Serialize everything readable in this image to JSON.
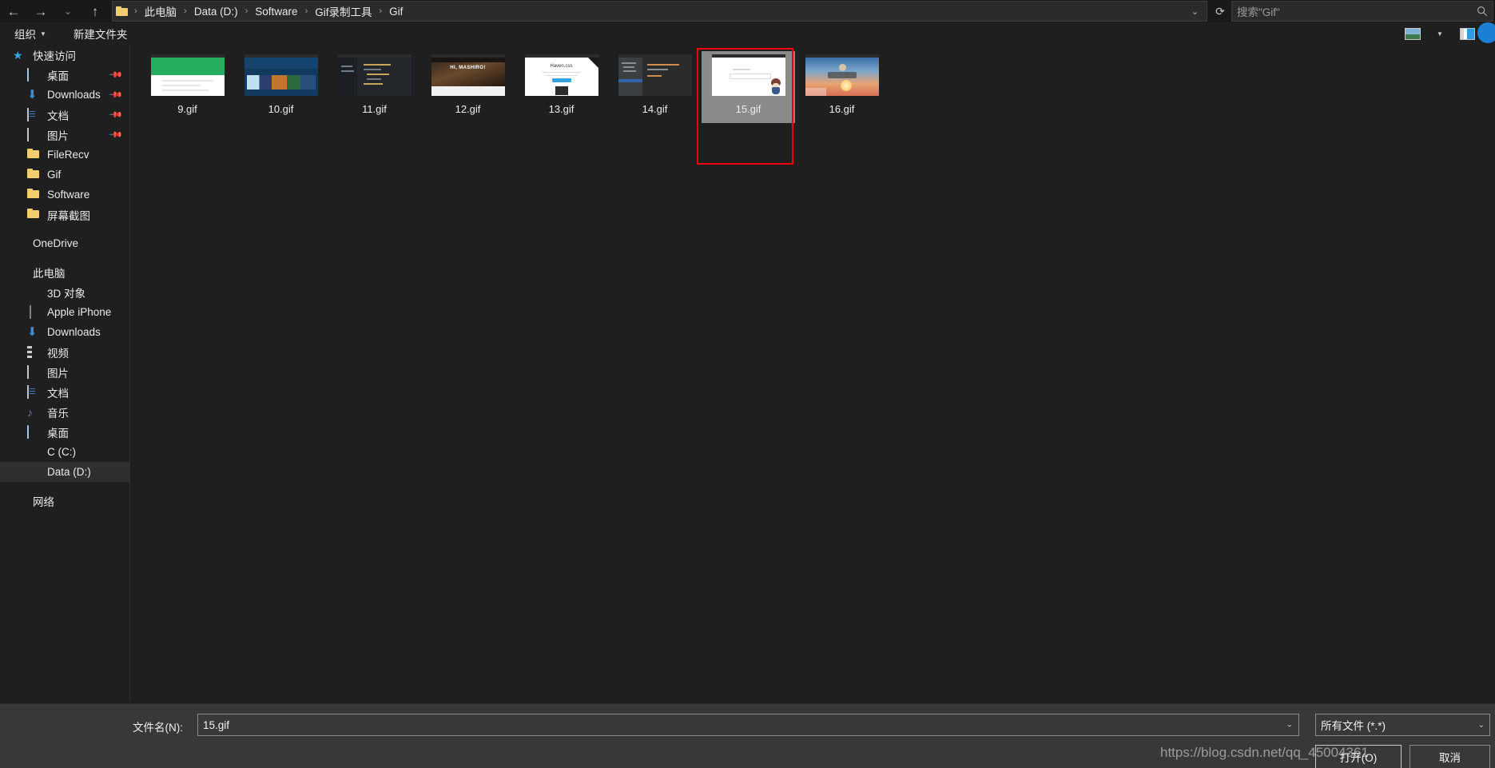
{
  "window": {
    "type": "file-open-dialog",
    "accent": "#1b7fd4",
    "annotation_color": "#f3000f"
  },
  "addressbar": {
    "back_icon": "arrow-left-icon",
    "forward_icon": "arrow-right-icon",
    "recent_icon": "chevron-down-icon",
    "up_icon": "arrow-up-icon",
    "folder_icon": "folder-icon",
    "breadcrumbs": [
      "此电脑",
      "Data (D:)",
      "Software",
      "Gif录制工具",
      "Gif"
    ],
    "separator": "›",
    "dropdown_icon": "chevron-down-icon",
    "refresh_icon": "refresh-icon"
  },
  "search": {
    "placeholder": "搜索\"Gif\"",
    "icon": "search-icon"
  },
  "commandbar": {
    "organize_label": "组织",
    "organize_caret": "▾",
    "new_folder_label": "新建文件夹",
    "view_icon": "picture-view-icon",
    "view_caret": "▾",
    "preview_pane_icon": "preview-pane-icon",
    "help_icon": "help-circle-icon"
  },
  "sidebar": {
    "groups": [
      {
        "header": {
          "label": "快速访问",
          "icon": "star-pin-icon"
        },
        "items": [
          {
            "label": "桌面",
            "icon": "desktop-icon",
            "pinned": true
          },
          {
            "label": "Downloads",
            "icon": "download-icon",
            "pinned": true
          },
          {
            "label": "文档",
            "icon": "document-icon",
            "pinned": true
          },
          {
            "label": "图片",
            "icon": "picture-icon",
            "pinned": true
          },
          {
            "label": "FileRecv",
            "icon": "folder-icon",
            "pinned": false
          },
          {
            "label": "Gif",
            "icon": "folder-icon",
            "pinned": false
          },
          {
            "label": "Software",
            "icon": "folder-icon",
            "pinned": false
          },
          {
            "label": "屏幕截图",
            "icon": "folder-icon",
            "pinned": false
          }
        ]
      },
      {
        "header": {
          "label": "OneDrive",
          "icon": "cloud-icon"
        },
        "items": []
      },
      {
        "header": {
          "label": "此电脑",
          "icon": "this-pc-icon"
        },
        "items": [
          {
            "label": "3D 对象",
            "icon": "3d-object-icon",
            "pinned": false
          },
          {
            "label": "Apple iPhone",
            "icon": "phone-icon",
            "pinned": false
          },
          {
            "label": "Downloads",
            "icon": "download-icon",
            "pinned": false
          },
          {
            "label": "视频",
            "icon": "video-icon",
            "pinned": false
          },
          {
            "label": "图片",
            "icon": "picture-icon",
            "pinned": false
          },
          {
            "label": "文档",
            "icon": "document-icon",
            "pinned": false
          },
          {
            "label": "音乐",
            "icon": "music-icon",
            "pinned": false
          },
          {
            "label": "桌面",
            "icon": "desktop-icon",
            "pinned": false
          },
          {
            "label": "C (C:)",
            "icon": "windows-drive-icon",
            "pinned": false
          },
          {
            "label": "Data (D:)",
            "icon": "hard-drive-icon",
            "pinned": false,
            "selected": true
          }
        ]
      },
      {
        "header": {
          "label": "网络",
          "icon": "network-icon"
        },
        "items": []
      }
    ]
  },
  "files": [
    {
      "name": "9.gif",
      "thumb": "green-landing-page",
      "selected": false
    },
    {
      "name": "10.gif",
      "thumb": "blue-wallpaper-site",
      "selected": false
    },
    {
      "name": "11.gif",
      "thumb": "dark-code-editor",
      "selected": false
    },
    {
      "name": "12.gif",
      "thumb": "hi-mashiro-blog",
      "selected": false
    },
    {
      "name": "13.gif",
      "thumb": "haven-css-white-page",
      "selected": false
    },
    {
      "name": "14.gif",
      "thumb": "dark-ide-window",
      "selected": false
    },
    {
      "name": "15.gif",
      "thumb": "white-page-with-chibi",
      "selected": true
    },
    {
      "name": "16.gif",
      "thumb": "sunset-sky-desktop",
      "selected": false
    }
  ],
  "thumb_text": {
    "mashiro_caption": "HI, MASHIRO!",
    "haven_title": "Haven.css"
  },
  "bottom": {
    "filename_label": "文件名(N):",
    "filename_value": "15.gif",
    "filename_caret": "⌄",
    "filetype_value": "所有文件 (*.*)",
    "filetype_caret": "⌄",
    "open_button": "打开(O)",
    "cancel_button": "取消"
  },
  "watermark": "https://blog.csdn.net/qq_45004361"
}
